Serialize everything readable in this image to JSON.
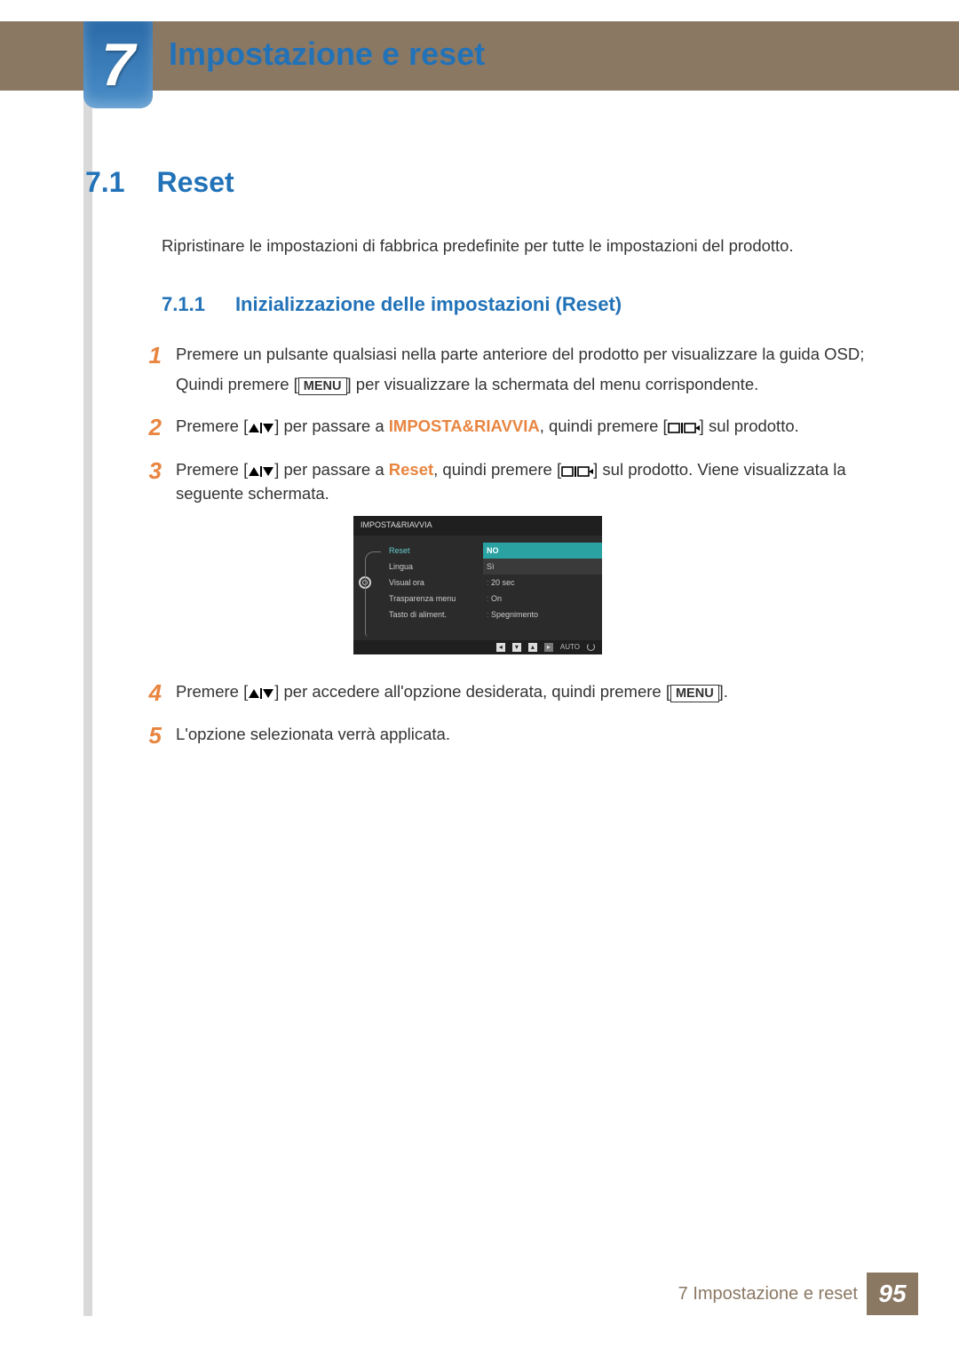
{
  "chapter": {
    "number": "7",
    "title": "Impostazione e reset"
  },
  "section": {
    "number": "7.1",
    "title": "Reset"
  },
  "intro": "Ripristinare le impostazioni di fabbrica predefinite per tutte le impostazioni del prodotto.",
  "subsection": {
    "number": "7.1.1",
    "title": "Inizializzazione delle impostazioni (Reset)"
  },
  "steps": {
    "n1": "1",
    "n2": "2",
    "n3": "3",
    "n4": "4",
    "n5": "5",
    "s1a": "Premere un pulsante qualsiasi nella parte anteriore del prodotto per visualizzare la guida OSD;",
    "s1b_pre": "Quindi premere [",
    "s1b_post": "] per visualizzare la schermata del menu corrispondente.",
    "s2_pre": "Premere [",
    "s2_mid": "] per passare a ",
    "s2_kw": "IMPOSTA&RIAVVIA",
    "s2_post1": ", quindi premere [",
    "s2_post2": "] sul prodotto.",
    "s3_pre": "Premere [",
    "s3_mid": "] per passare a ",
    "s3_kw": "Reset",
    "s3_post1": ", quindi premere [",
    "s3_post2": "] sul prodotto. Viene visualizzata la seguente schermata.",
    "s4_pre": "Premere [",
    "s4_mid": "] per accedere all'opzione desiderata, quindi premere [",
    "s4_post": "].",
    "s5": "L'opzione selezionata verrà applicata.",
    "menu_label": "MENU"
  },
  "osd": {
    "title": "IMPOSTA&RIAVVIA",
    "left": [
      "Reset",
      "Lingua",
      "Visual ora",
      "Trasparenza menu",
      "Tasto di aliment."
    ],
    "right_no": "NO",
    "right_si": "Sì",
    "right": [
      "20 sec",
      "On",
      "Spegnimento"
    ],
    "footer_auto": "AUTO"
  },
  "footer": {
    "text": "7 Impostazione e reset",
    "page": "95"
  }
}
